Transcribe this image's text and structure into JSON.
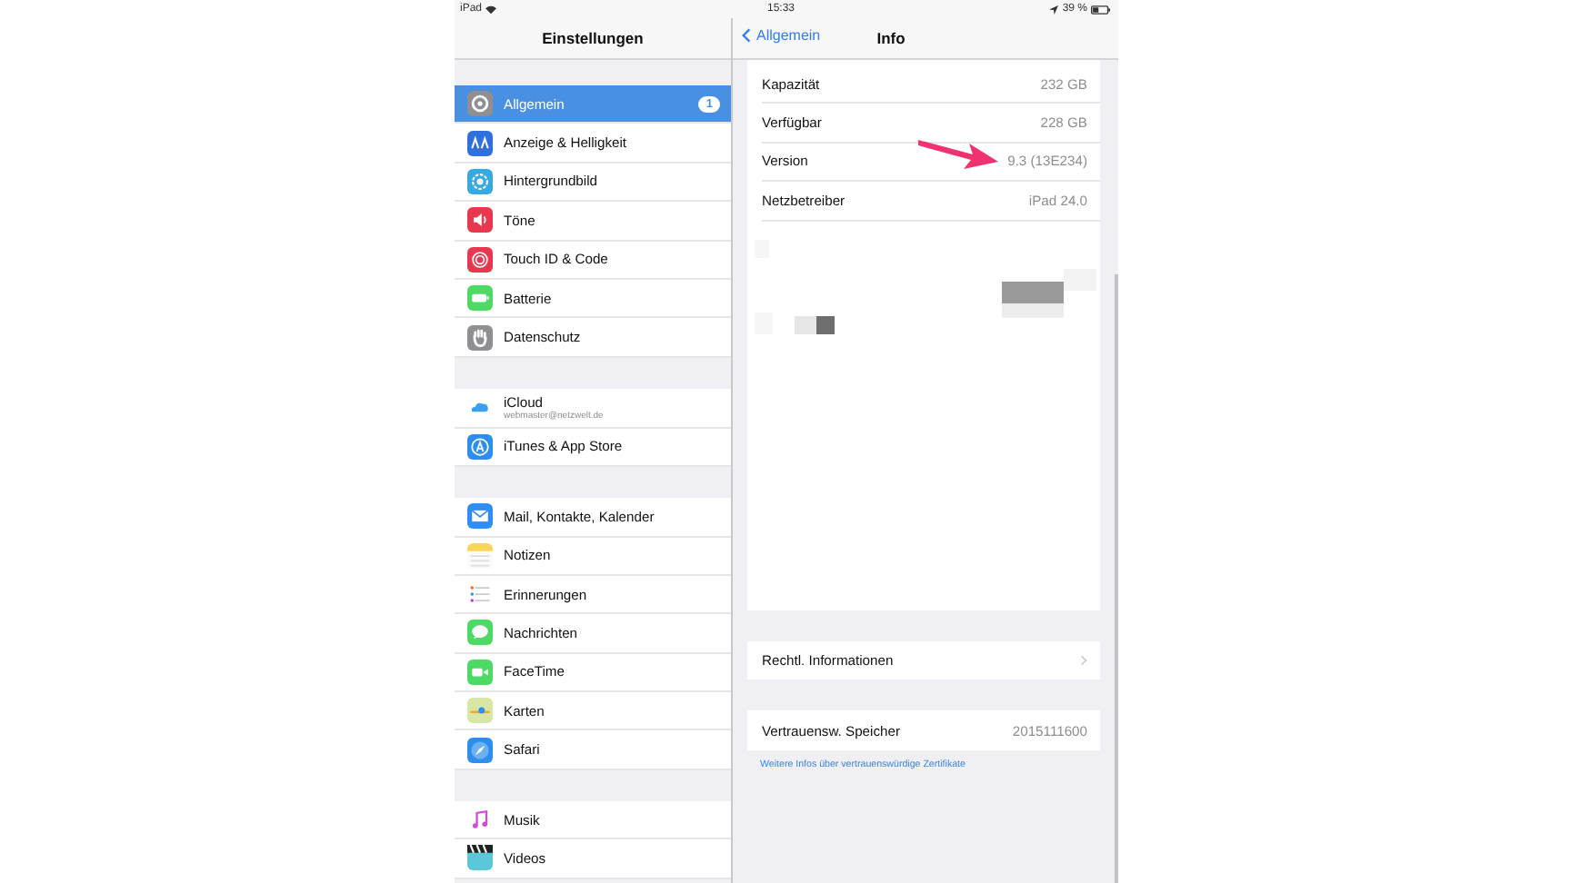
{
  "status_bar": {
    "device": "iPad",
    "time": "15:33",
    "battery": "39 %"
  },
  "sidebar": {
    "title": "Einstellungen",
    "groups": [
      {
        "items": [
          {
            "label": "Allgemein",
            "kind": "gear",
            "color": "#8e8e93",
            "selected": true,
            "badge": "1"
          },
          {
            "label": "Anzeige & Helligkeit",
            "kind": "display",
            "color": "#2f6fdf",
            "selected": false
          },
          {
            "label": "Hintergrundbild",
            "kind": "flower",
            "color": "#35a9e0",
            "selected": false
          },
          {
            "label": "Töne",
            "kind": "speaker",
            "color": "#e8384f",
            "selected": false
          },
          {
            "label": "Touch ID & Code",
            "kind": "fingerprint",
            "color": "#e8384f",
            "selected": false
          },
          {
            "label": "Batterie",
            "kind": "battery",
            "color": "#4cd964",
            "selected": false
          },
          {
            "label": "Datenschutz",
            "kind": "hand",
            "color": "#8e8e93",
            "selected": false
          }
        ]
      },
      {
        "items": [
          {
            "label": "iCloud",
            "subtitle": "webmaster@netzwelt.de",
            "kind": "cloud",
            "selected": false
          },
          {
            "label": "iTunes & App Store",
            "kind": "appstore",
            "color": "#2d8ef0",
            "selected": false
          }
        ]
      },
      {
        "items": [
          {
            "label": "Mail, Kontakte, Kalender",
            "kind": "mail",
            "color": "#2f8ef5",
            "selected": false
          },
          {
            "label": "Notizen",
            "kind": "notes",
            "color": "#f9d65a",
            "selected": false
          },
          {
            "label": "Erinnerungen",
            "kind": "list",
            "selected": false
          },
          {
            "label": "Nachrichten",
            "kind": "bubble",
            "color": "#4cd964",
            "selected": false
          },
          {
            "label": "FaceTime",
            "kind": "camera",
            "color": "#4cd964",
            "selected": false
          },
          {
            "label": "Karten",
            "kind": "map",
            "color": "#d8e7a6",
            "selected": false
          },
          {
            "label": "Safari",
            "kind": "compass",
            "color": "#2d8ef0",
            "selected": false
          }
        ]
      },
      {
        "items": [
          {
            "label": "Musik",
            "kind": "music",
            "selected": false
          },
          {
            "label": "Videos",
            "kind": "clapper",
            "color": "#5ac8d8",
            "selected": false
          }
        ]
      }
    ]
  },
  "detail": {
    "back": "Allgemein",
    "title": "Info",
    "info_rows": [
      {
        "label": "Kapazität",
        "value": "232 GB"
      },
      {
        "label": "Verfügbar",
        "value": "228 GB"
      },
      {
        "label": "Version",
        "value": "9.3 (13E234)"
      },
      {
        "label": "Netzbetreiber",
        "value": "iPad 24.0"
      }
    ],
    "legal": {
      "label": "Rechtl. Informationen"
    },
    "trust": {
      "label": "Vertrauensw. Speicher",
      "value": "2015111600"
    },
    "link": "Weitere Infos über vertrauenswürdige Zertifikate"
  }
}
